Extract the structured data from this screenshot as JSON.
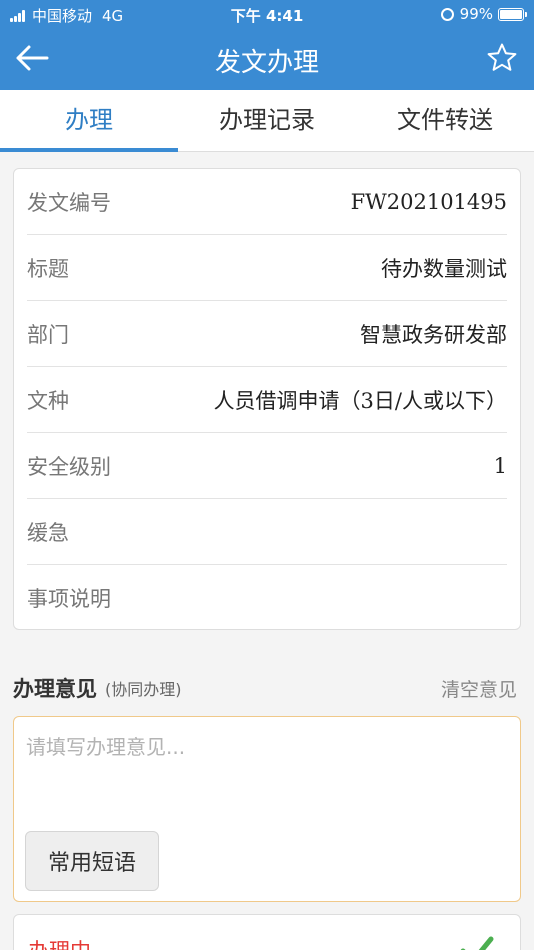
{
  "status_bar": {
    "carrier": "中国移动",
    "network": "4G",
    "time": "下午 4:41",
    "battery": "99%",
    "battery_level": 0.99
  },
  "nav": {
    "back_icon": "arrow-left-icon",
    "title": "发文办理",
    "favorite_icon": "star-icon"
  },
  "tabs": [
    {
      "label": "办理",
      "active": true
    },
    {
      "label": "办理记录",
      "active": false
    },
    {
      "label": "文件转送",
      "active": false
    }
  ],
  "fields": [
    {
      "label": "发文编号",
      "value": "FW202101495"
    },
    {
      "label": "标题",
      "value": "待办数量测试"
    },
    {
      "label": "部门",
      "value": "智慧政务研发部"
    },
    {
      "label": "文种",
      "value": "人员借调申请（3日/人或以下）"
    },
    {
      "label": "安全级别",
      "value": "1"
    },
    {
      "label": "缓急",
      "value": ""
    },
    {
      "label": "事项说明",
      "value": ""
    }
  ],
  "opinion": {
    "title": "办理意见",
    "subtitle": "(协同办理)",
    "clear_label": "清空意见",
    "placeholder": "请填写办理意见...",
    "value": "",
    "phrase_button": "常用短语"
  },
  "status": {
    "label": "办理中",
    "icon": "check-icon",
    "accent_color": "#e53935",
    "check_color": "#4caf50"
  },
  "colors": {
    "primary": "#3a8bd3",
    "input_border": "#f0c98a"
  }
}
